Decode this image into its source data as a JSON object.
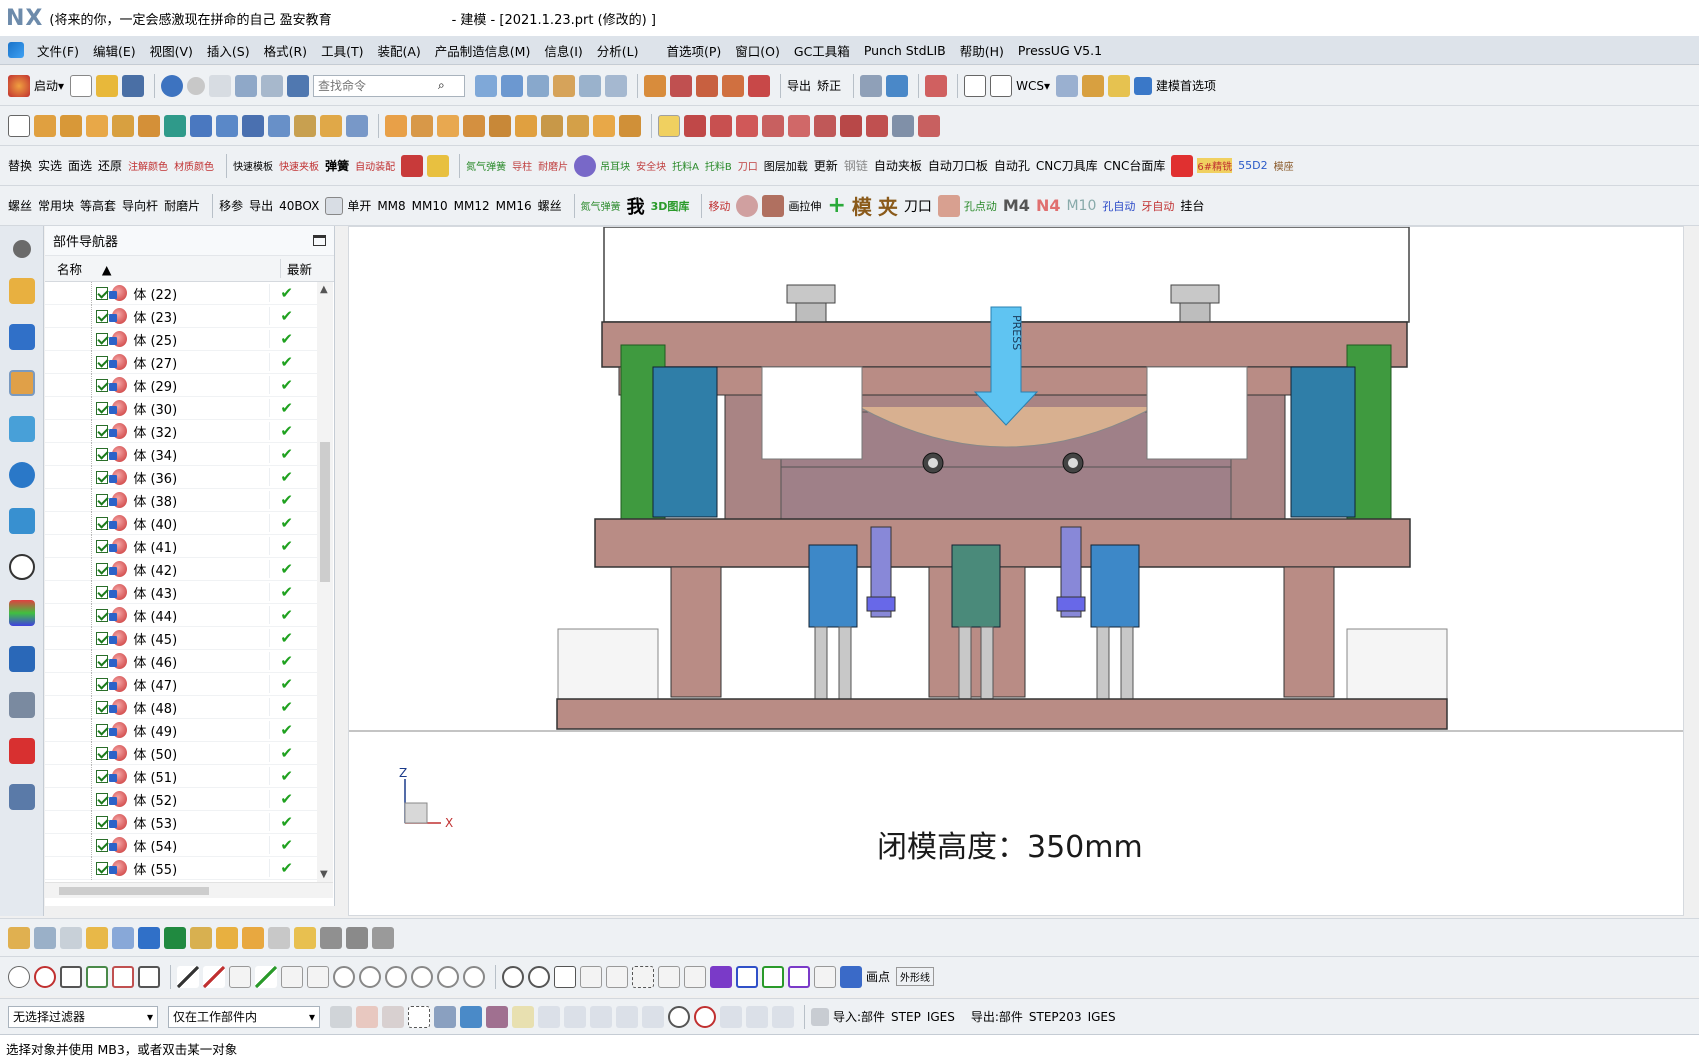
{
  "titlebar": {
    "logo": "NX",
    "motto": "(将来的你，一定会感激现在拼命的自己 盈安教育",
    "document": "- 建模 - [2021.1.23.prt  (修改的) ]"
  },
  "menu": {
    "items": [
      "文件(F)",
      "编辑(E)",
      "视图(V)",
      "插入(S)",
      "格式(R)",
      "工具(T)",
      "装配(A)",
      "产品制造信息(M)",
      "信息(I)",
      "分析(L)",
      "首选项(P)",
      "窗口(O)",
      "GC工具箱",
      "Punch StdLIB",
      "帮助(H)",
      "PressUG V5.1"
    ]
  },
  "toolbar1": {
    "start_label": "启动",
    "search_placeholder": "查找命令",
    "export_label": "导出",
    "correct_label": "矫正",
    "wcs_label": "WCS",
    "modeling_pref_label": "建模首选项"
  },
  "toolbar3": {
    "labels": [
      "替换",
      "实选",
      "面选",
      "还原",
      "注解颜色",
      "材质颜色",
      "快速模板",
      "快速夹板",
      "弹簧",
      "自动装配",
      "氮气弹簧",
      "导柱",
      "耐磨片",
      "吊耳块",
      "安全块",
      "托料A",
      "托料B",
      "刀口",
      "图层加载",
      "更新",
      "钢链",
      "自动夹板",
      "自动刀口板",
      "自动孔",
      "CNC刀具库",
      "CNC台面库",
      "6#精铣",
      "55D2",
      "模座"
    ]
  },
  "toolbar4": {
    "labels": [
      "螺丝",
      "常用块",
      "等高套",
      "导向杆",
      "耐磨片",
      "移参",
      "导出",
      "40BOX",
      "单开",
      "MM8",
      "MM10",
      "MM12",
      "MM16",
      "螺丝",
      "氮气弹簧",
      "我",
      "3D图库",
      "移动",
      "画拉伸",
      "模",
      "夹",
      "刀口",
      "孔点动",
      "M4",
      "N4",
      "M10",
      "孔自动",
      "牙自动",
      "挂台"
    ]
  },
  "navigator": {
    "title": "部件导航器",
    "col_name": "名称",
    "col_latest": "最新",
    "rows": [
      "体 (22)",
      "体 (23)",
      "体 (25)",
      "体 (27)",
      "体 (29)",
      "体 (30)",
      "体 (32)",
      "体 (34)",
      "体 (36)",
      "体 (38)",
      "体 (40)",
      "体 (41)",
      "体 (42)",
      "体 (43)",
      "体 (44)",
      "体 (45)",
      "体 (46)",
      "体 (47)",
      "体 (48)",
      "体 (49)",
      "体 (50)",
      "体 (51)",
      "体 (52)",
      "体 (53)",
      "体 (54)",
      "体 (55)"
    ]
  },
  "viewport": {
    "press_label": "PRESS",
    "closed_height_label": "闭模高度：350mm",
    "axis_z": "Z",
    "axis_x": "X"
  },
  "bottom": {
    "filter_value": "无选择过滤器",
    "scope_value": "仅在工作部件内",
    "import_part": "导入:部件",
    "step": "STEP",
    "iges": "IGES",
    "export_part": "导出:部件",
    "step203": "STEP203",
    "iges2": "IGES",
    "point_label": "画点",
    "shape_label": "外形线"
  },
  "status": {
    "message": "选择对象并使用 MB3，或者双击某一对象"
  },
  "colors": {
    "plate": "#b98c85",
    "plate_inner": "#a98484",
    "teal": "#2f7ea8",
    "green": "#3f9a3f",
    "press_arrow": "#5fc4f2",
    "check": "#1fa11f"
  }
}
